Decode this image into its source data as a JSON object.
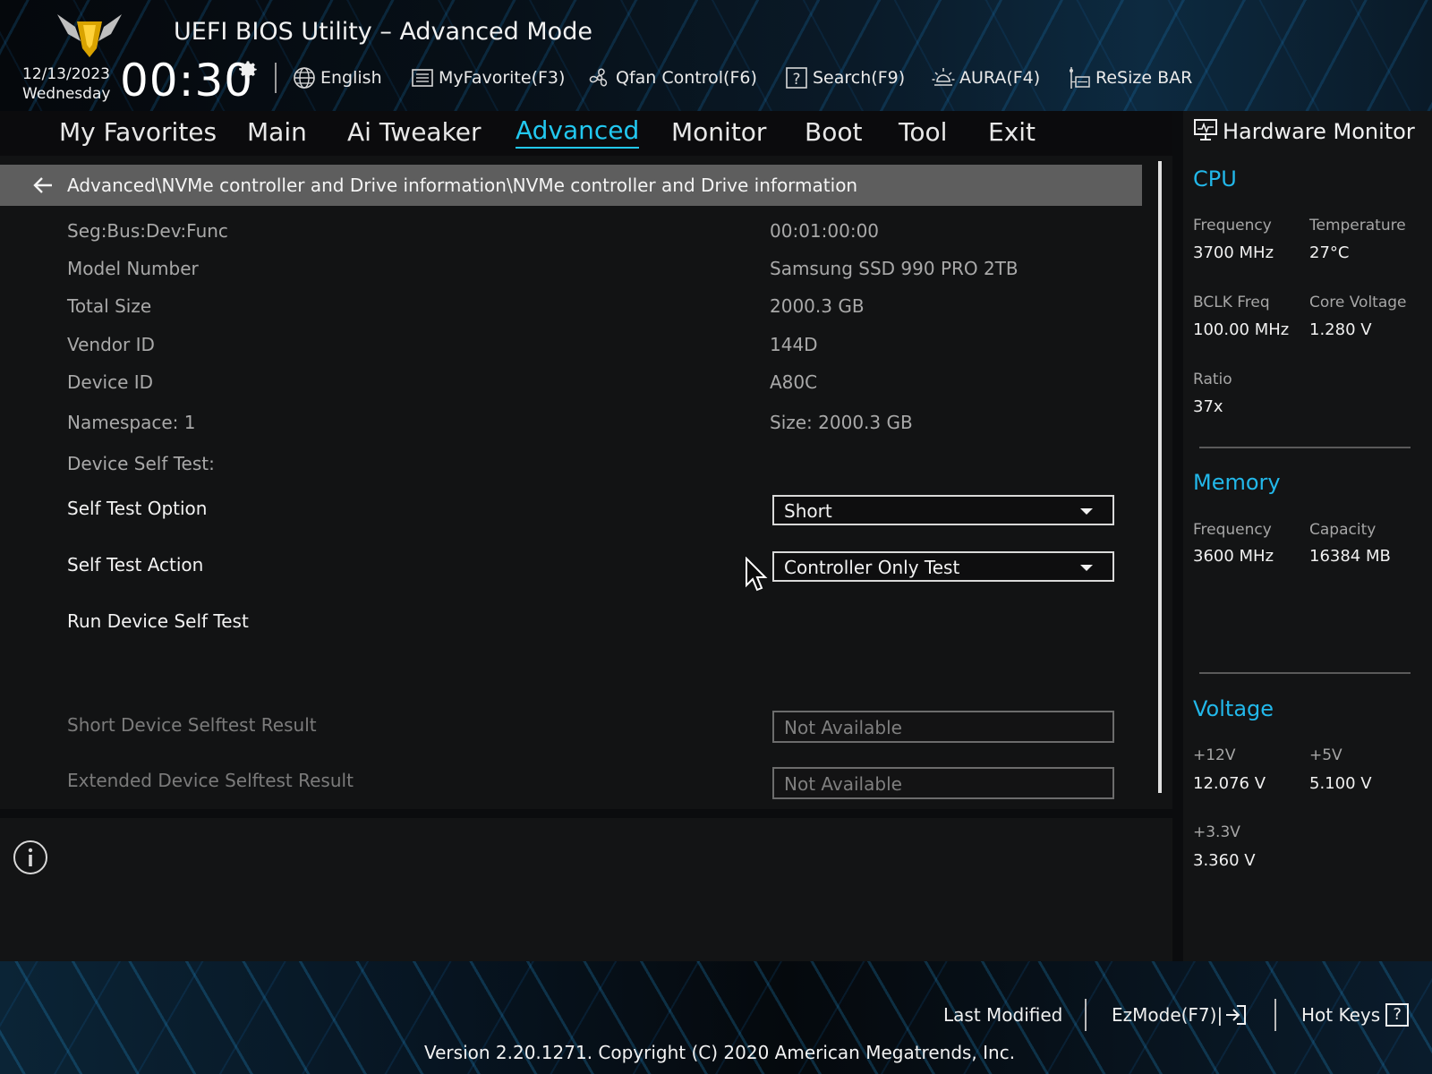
{
  "header": {
    "title": "UEFI BIOS Utility – Advanced Mode",
    "date": "12/13/2023",
    "weekday": "Wednesday",
    "time": "00:30",
    "tools": [
      {
        "label": "English",
        "icon": "globe-icon"
      },
      {
        "label": "MyFavorite(F3)",
        "icon": "favorite-list-icon"
      },
      {
        "label": "Qfan Control(F6)",
        "icon": "fan-icon"
      },
      {
        "label": "Search(F9)",
        "icon": "search-help-icon"
      },
      {
        "label": "AURA(F4)",
        "icon": "aura-light-icon"
      },
      {
        "label": "ReSize BAR",
        "icon": "resize-bar-icon"
      }
    ]
  },
  "nav": {
    "items": [
      "My Favorites",
      "Main",
      "Ai Tweaker",
      "Advanced",
      "Monitor",
      "Boot",
      "Tool",
      "Exit"
    ],
    "active": "Advanced"
  },
  "breadcrumb": "Advanced\\NVMe controller and Drive information\\NVMe controller and Drive information",
  "rows": [
    {
      "label": "Seg:Bus:Dev:Func",
      "value": "00:01:00:00"
    },
    {
      "label": "Model Number",
      "value": "Samsung SSD 990 PRO 2TB"
    },
    {
      "label": "Total Size",
      "value": "2000.3 GB"
    },
    {
      "label": "Vendor ID",
      "value": "144D"
    },
    {
      "label": "Device ID",
      "value": "A80C"
    },
    {
      "label": "Namespace: 1",
      "value": "Size: 2000.3 GB"
    },
    {
      "label": "Device Self Test:",
      "value": ""
    }
  ],
  "settings": {
    "self_test_option": {
      "label": "Self Test Option",
      "value": "Short"
    },
    "self_test_action": {
      "label": "Self Test Action",
      "value": "Controller Only Test"
    },
    "run_self_test": {
      "label": "Run Device Self Test"
    },
    "short_result": {
      "label": "Short Device Selftest Result",
      "value": "Not Available"
    },
    "extended_result": {
      "label": "Extended Device Selftest Result",
      "value": "Not Available"
    }
  },
  "hardware_monitor": {
    "title": "Hardware Monitor",
    "cpu": {
      "title": "CPU",
      "frequency_label": "Frequency",
      "frequency": "3700 MHz",
      "temperature_label": "Temperature",
      "temperature": "27°C",
      "bclk_label": "BCLK Freq",
      "bclk": "100.00 MHz",
      "core_voltage_label": "Core Voltage",
      "core_voltage": "1.280 V",
      "ratio_label": "Ratio",
      "ratio": "37x"
    },
    "memory": {
      "title": "Memory",
      "frequency_label": "Frequency",
      "frequency": "3600 MHz",
      "capacity_label": "Capacity",
      "capacity": "16384 MB"
    },
    "voltage": {
      "title": "Voltage",
      "v12_label": "+12V",
      "v12": "12.076 V",
      "v5_label": "+5V",
      "v5": "5.100 V",
      "v33_label": "+3.3V",
      "v33": "3.360 V"
    }
  },
  "footer": {
    "last_modified": "Last Modified",
    "ezmode": "EzMode(F7)|",
    "hotkeys": "Hot Keys",
    "hotkeys_glyph": "?",
    "version": "Version 2.20.1271. Copyright (C) 2020 American Megatrends, Inc."
  },
  "colors": {
    "accent": "#22c8f0",
    "panel": "#121314",
    "breadcrumb_bg": "#5e5e5e"
  }
}
